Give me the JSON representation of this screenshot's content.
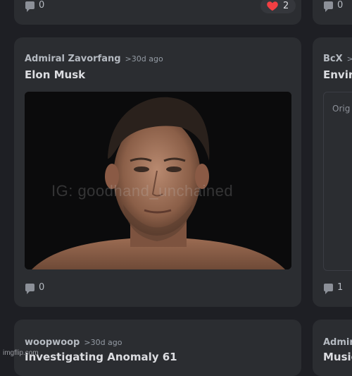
{
  "top_row": {
    "left_comment_count": "0",
    "like_count": "2",
    "right_comment_count": "0"
  },
  "main_post": {
    "author": "Admiral Zavorfang",
    "age": ">30d ago",
    "title": "Elon Musk",
    "image_watermark": "IG: goodhand_unchained",
    "comment_count": "0"
  },
  "right_post": {
    "author": "BcX",
    "age": ">",
    "title": "Envir",
    "preview_text": "Orig",
    "comment_count": "1"
  },
  "bottom_post": {
    "author": "woopwoop",
    "age": ">30d ago",
    "title": "Investigating Anomaly 61"
  },
  "bottom_right_post": {
    "author": "Admir",
    "title": "Music"
  },
  "footer": {
    "watermark": "imgflip.com"
  },
  "colors": {
    "background": "#1e1f24",
    "card": "#2b2d31",
    "heart": "#f23f43"
  }
}
